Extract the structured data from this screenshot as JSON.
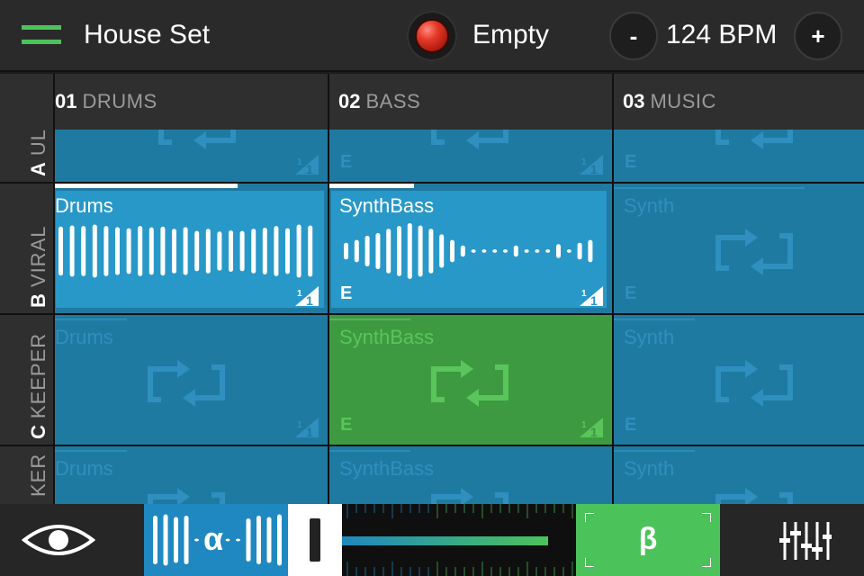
{
  "topbar": {
    "menu_icon": "hamburger-menu-icon",
    "set_title": "House Set",
    "record_icon": "record-button-icon",
    "record_status": "Empty",
    "bpm_minus": "-",
    "bpm_value": "124 BPM",
    "bpm_plus": "+"
  },
  "columns": [
    {
      "num": "01",
      "name": "DRUMS"
    },
    {
      "num": "02",
      "name": "BASS"
    },
    {
      "num": "03",
      "name": "MUSIC"
    }
  ],
  "rows": [
    {
      "letter": "A",
      "name": "UL"
    },
    {
      "letter": "B",
      "name": "VIRAL"
    },
    {
      "letter": "C",
      "name": "KEEPER"
    },
    {
      "letter": "",
      "name": "KER"
    }
  ],
  "cells": {
    "b1": {
      "name": "Drums",
      "quant": "1/1",
      "progress": 0.67
    },
    "b2": {
      "name": "SynthBass",
      "e": "E",
      "quant": "1/1",
      "progress": 0.3
    },
    "b3": {
      "name": "Synth",
      "e": "E"
    },
    "a2": {
      "e": "E"
    },
    "a3": {
      "e": "E"
    },
    "c1": {
      "name": "Drums"
    },
    "c2": {
      "name": "SynthBass",
      "e": "E"
    },
    "c3": {
      "name": "Synth",
      "e": "E"
    },
    "d1": {
      "name": "Drums"
    },
    "d2": {
      "name": "SynthBass"
    },
    "d3": {
      "name": "Synth"
    }
  },
  "bottombar": {
    "eye_icon": "eye-icon",
    "alpha": "α",
    "beta": "β",
    "crossfader_value": 0.88,
    "mixer_icon": "mixer-sliders-icon"
  },
  "colors": {
    "accent_green": "#4cc35a",
    "clip_blue": "#2898c9",
    "slot_blue": "#1f7aa1",
    "queued_green": "#3d9a41",
    "record_red": "#e53927"
  }
}
